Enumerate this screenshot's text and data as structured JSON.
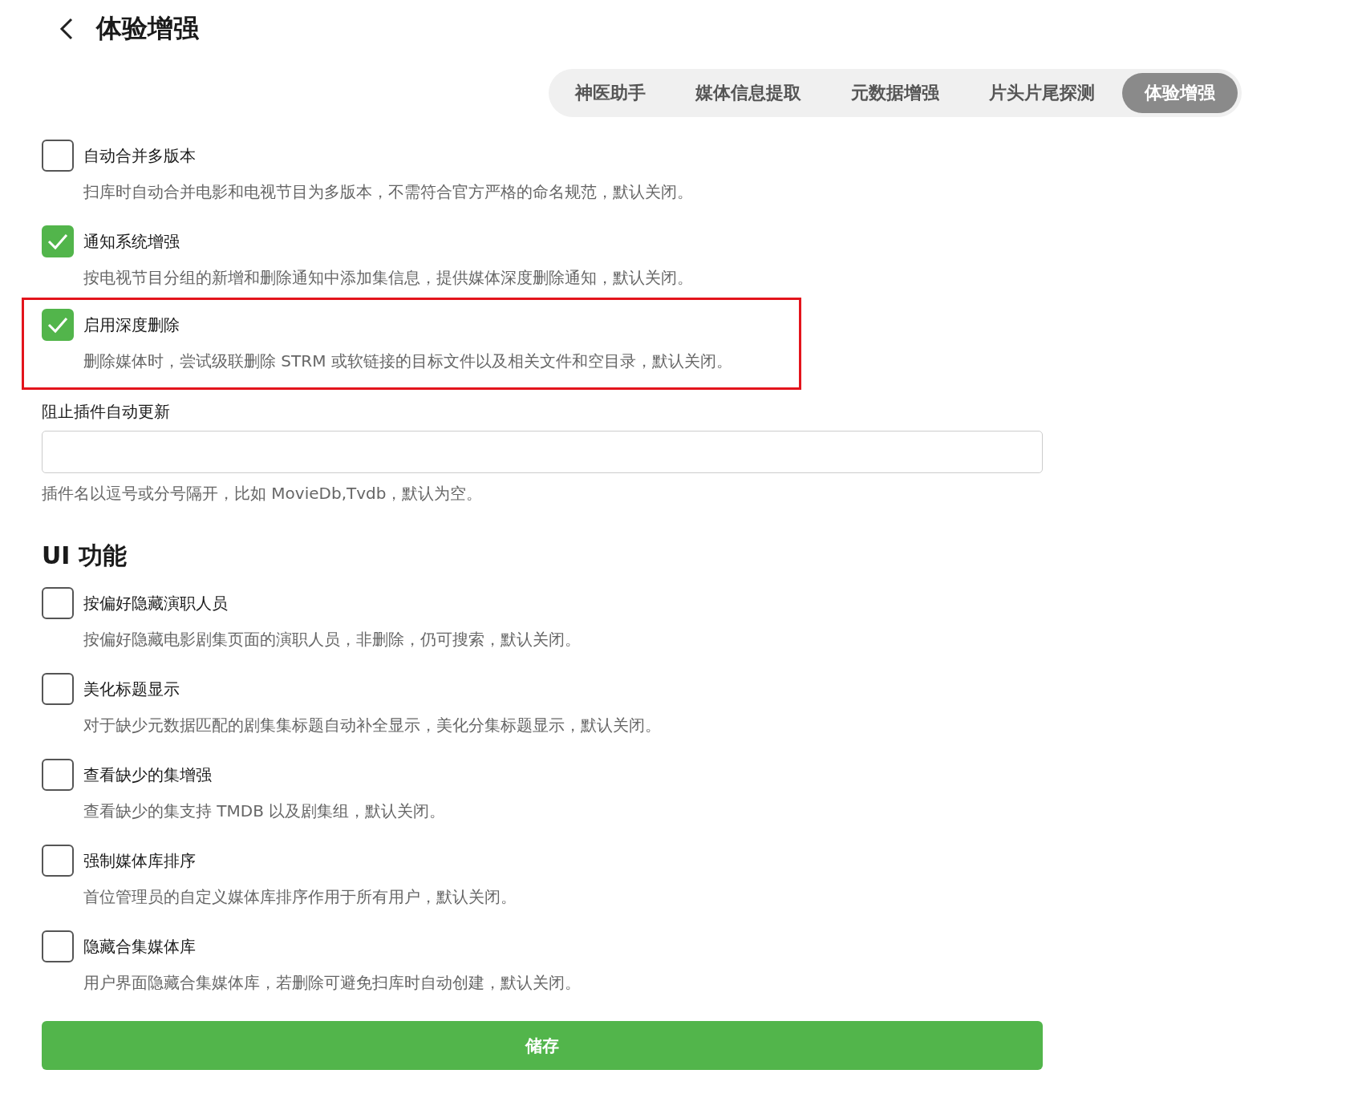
{
  "header": {
    "title": "体验增强"
  },
  "tabs": [
    {
      "label": "神医助手",
      "selected": false
    },
    {
      "label": "媒体信息提取",
      "selected": false
    },
    {
      "label": "元数据增强",
      "selected": false
    },
    {
      "label": "片头片尾探测",
      "selected": false
    },
    {
      "label": "体验增强",
      "selected": true
    }
  ],
  "options": [
    {
      "label": "自动合并多版本",
      "checked": false,
      "highlighted": false,
      "description": "扫库时自动合并电影和电视节目为多版本，不需符合官方严格的命名规范，默认关闭。"
    },
    {
      "label": "通知系统增强",
      "checked": true,
      "highlighted": false,
      "description": "按电视节目分组的新增和删除通知中添加集信息，提供媒体深度删除通知，默认关闭。"
    },
    {
      "label": "启用深度删除",
      "checked": true,
      "highlighted": true,
      "description": "删除媒体时，尝试级联删除 STRM 或软链接的目标文件以及相关文件和空目录，默认关闭。"
    }
  ],
  "plugin_field": {
    "label": "阻止插件自动更新",
    "hint": "插件名以逗号或分号隔开，比如 MovieDb,Tvdb，默认为空。"
  },
  "ui_section": {
    "heading": "UI 功能",
    "options": [
      {
        "label": "按偏好隐藏演职人员",
        "checked": false,
        "highlighted": false,
        "description": "按偏好隐藏电影剧集页面的演职人员，非删除，仍可搜索，默认关闭。"
      },
      {
        "label": "美化标题显示",
        "checked": false,
        "highlighted": false,
        "description": "对于缺少元数据匹配的剧集集标题自动补全显示，美化分集标题显示，默认关闭。"
      },
      {
        "label": "查看缺少的集增强",
        "checked": false,
        "highlighted": false,
        "description": "查看缺少的集支持 TMDB 以及剧集组，默认关闭。"
      },
      {
        "label": "强制媒体库排序",
        "checked": false,
        "highlighted": false,
        "description": "首位管理员的自定义媒体库排序作用于所有用户，默认关闭。"
      },
      {
        "label": "隐藏合集媒体库",
        "checked": false,
        "highlighted": false,
        "description": "用户界面隐藏合集媒体库，若删除可避免扫库时自动创建，默认关闭。"
      }
    ]
  },
  "save_button": {
    "label": "储存"
  }
}
